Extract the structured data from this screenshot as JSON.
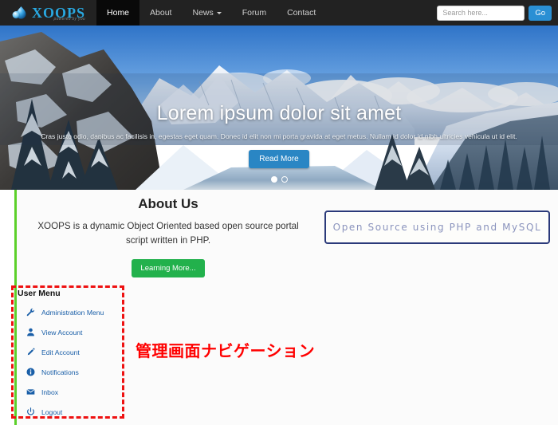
{
  "brand": {
    "name": "XOOPS",
    "tagline": "powered by you",
    "icon": "water-drop-logo-icon",
    "color": "#29a8e0"
  },
  "nav": {
    "items": [
      {
        "label": "Home",
        "active": true,
        "caret": false
      },
      {
        "label": "About",
        "active": false,
        "caret": false
      },
      {
        "label": "News",
        "active": false,
        "caret": true
      },
      {
        "label": "Forum",
        "active": false,
        "caret": false
      },
      {
        "label": "Contact",
        "active": false,
        "caret": false
      }
    ],
    "search": {
      "placeholder": "Search here...",
      "value": "",
      "button_label": "Go",
      "button_color": "#2a8fd4"
    },
    "background": "#222222"
  },
  "hero": {
    "title": "Lorem ipsum dolor sit amet",
    "subtitle": "Cras justo odio, dapibus ac facilisis in, egestas eget quam. Donec id elit non mi porta gravida at eget metus. Nullam id dolor id nibh ultricies vehicula ut id elit.",
    "button_label": "Read More",
    "button_color": "#2a86c4",
    "image_alt": "snowy-mountain-lake-photo",
    "carousel": {
      "slides": 2,
      "active_index": 0
    }
  },
  "about": {
    "heading": "About Us",
    "body": "XOOPS is a dynamic Object Oriented based open source portal script written in PHP.",
    "button_label": "Learning More...",
    "button_color": "#22b14c"
  },
  "promo": {
    "text": "Open Source using PHP and MySQL",
    "border_color": "#2b3a7a"
  },
  "user_menu": {
    "title": "User Menu",
    "items": [
      {
        "label": "Administration Menu",
        "icon": "wrench-icon"
      },
      {
        "label": "View Account",
        "icon": "user-icon"
      },
      {
        "label": "Edit Account",
        "icon": "pencil-icon"
      },
      {
        "label": "Notifications",
        "icon": "info-circle-icon"
      },
      {
        "label": "Inbox",
        "icon": "envelope-icon"
      },
      {
        "label": "Logout",
        "icon": "power-icon"
      }
    ],
    "link_color": "#1a5fa8",
    "highlight_color": "#ee1111"
  },
  "annotation": {
    "text": "管理画面ナビゲーション",
    "color": "#ff0000"
  },
  "accent": {
    "green_rule": "#5cd02a"
  }
}
